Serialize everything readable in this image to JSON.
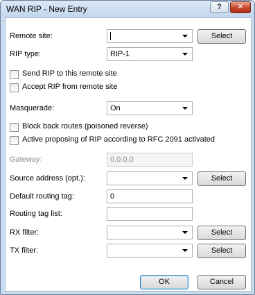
{
  "window": {
    "title": "WAN RIP - New Entry",
    "help_label": "?",
    "close_label": "✕"
  },
  "form": {
    "remote_site": {
      "label": "Remote site:",
      "value": "",
      "select_label": "Select"
    },
    "rip_type": {
      "label": "RIP type:",
      "value": "RIP-1"
    },
    "send_rip": {
      "label": "Send RIP to this remote site",
      "checked": false
    },
    "accept_rip": {
      "label": "Accept RIP from remote site",
      "checked": false
    },
    "masquerade": {
      "label": "Masquerade:",
      "value": "On"
    },
    "block_back_routes": {
      "label": "Block back routes (poisoned reverse)",
      "checked": false
    },
    "active_proposing": {
      "label": "Active proposing of RIP according to RFC 2091 activated",
      "checked": false
    },
    "gateway": {
      "label": "Gateway:",
      "value": "0.0.0.0"
    },
    "source_address": {
      "label": "Source address (opt.):",
      "value": "",
      "select_label": "Select"
    },
    "default_routing_tag": {
      "label": "Default routing tag:",
      "value": "0"
    },
    "routing_tag_list": {
      "label": "Routing tag list:",
      "value": ""
    },
    "rx_filter": {
      "label": "RX filter:",
      "value": "",
      "select_label": "Select"
    },
    "tx_filter": {
      "label": "TX filter:",
      "value": "",
      "select_label": "Select"
    }
  },
  "buttons": {
    "ok": "OK",
    "cancel": "Cancel"
  }
}
